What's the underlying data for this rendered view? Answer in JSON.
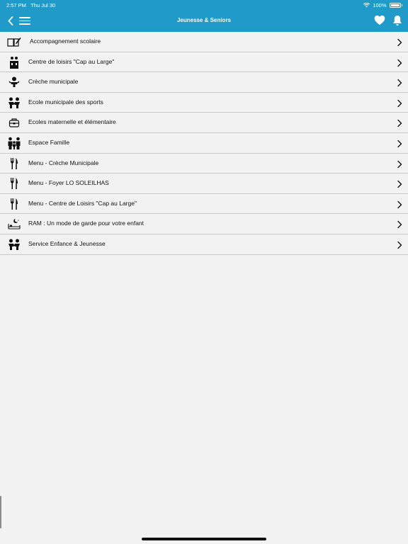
{
  "status_bar": {
    "time": "2:57 PM",
    "date": "Thu Jul 30",
    "battery": "100%",
    "icons": [
      "wifi-icon",
      "battery-icon"
    ]
  },
  "header": {
    "title": "Jeunesse & Seniors",
    "icons": [
      "back-icon",
      "menu-icon",
      "heart-icon",
      "bell-icon"
    ]
  },
  "colors": {
    "header_bg": "#1f9ac9",
    "page_bg": "#f2f2f2",
    "divider": "#c9c9c9"
  },
  "items": [
    {
      "label": "Accompagnement scolaire",
      "icon": "book-pen-icon"
    },
    {
      "label": "Centre de loisirs \"Cap au Large\"",
      "icon": "children-building-icon"
    },
    {
      "label": "Crèche municipale",
      "icon": "baby-icon"
    },
    {
      "label": "Ecole municipale des sports",
      "icon": "kids-icon"
    },
    {
      "label": "Ecoles maternelle et élémentaire",
      "icon": "school-bag-icon"
    },
    {
      "label": "Espace Famille",
      "icon": "family-icon"
    },
    {
      "label": "Menu - Crèche Municipale",
      "icon": "fork-knife-icon"
    },
    {
      "label": "Menu - Foyer LO SOLEILHAS",
      "icon": "fork-knife-icon"
    },
    {
      "label": "Menu - Centre de Loisirs \"Cap au Large\"",
      "icon": "fork-knife-icon"
    },
    {
      "label": "RAM : Un mode de garde pour votre enfant",
      "icon": "night-bed-icon"
    },
    {
      "label": "Service Enfance & Jeunesse",
      "icon": "kids-icon"
    }
  ]
}
